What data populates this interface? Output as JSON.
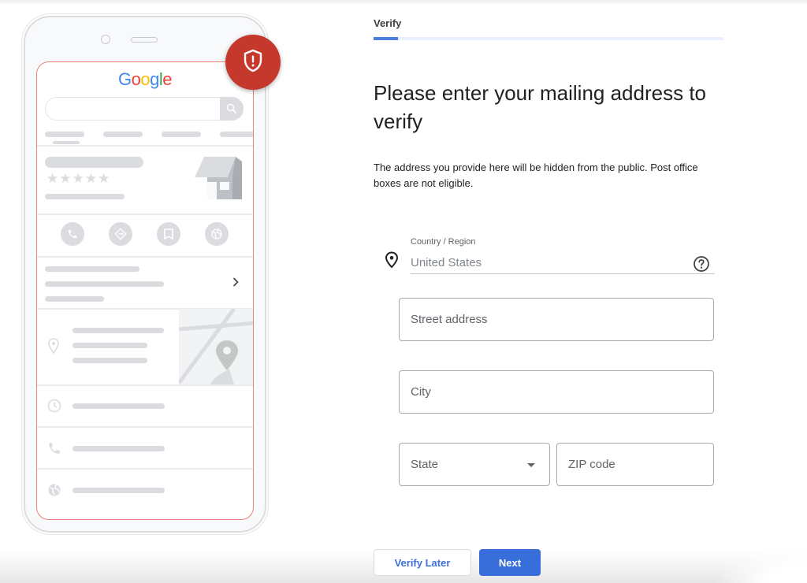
{
  "header": {
    "step_label": "Verify",
    "progress_percent": 7
  },
  "main": {
    "title": "Please enter your mailing address to verify",
    "description": "The address you provide here will be hidden from the public. Post office boxes are not eligible."
  },
  "form": {
    "country": {
      "label": "Country / Region",
      "value": "United States",
      "icon": "location-pin-icon",
      "help_icon": "help-circle-icon"
    },
    "street": {
      "placeholder": "Street address",
      "value": ""
    },
    "city": {
      "placeholder": "City",
      "value": ""
    },
    "state": {
      "placeholder": "State",
      "value": ""
    },
    "zip": {
      "placeholder": "ZIP code",
      "value": ""
    }
  },
  "actions": {
    "verify_later_label": "Verify Later",
    "next_label": "Next"
  },
  "illustration": {
    "logo_letters": [
      "G",
      "o",
      "o",
      "g",
      "l",
      "e"
    ],
    "logo_colors": [
      "#4285f4",
      "#ea4335",
      "#fbbc05",
      "#4285f4",
      "#34a853",
      "#ea4335"
    ],
    "badge_icon": "shield-alert-icon",
    "badge_color": "#c5392d",
    "action_icons": [
      "phone-icon",
      "directions-icon",
      "bookmark-icon",
      "globe-icon"
    ],
    "detail_icons": [
      "clock-icon",
      "phone-icon",
      "globe-icon"
    ]
  },
  "colors": {
    "accent": "#376ed9",
    "progress_fill": "#4a7fe0",
    "progress_track": "#e8f0fe"
  }
}
